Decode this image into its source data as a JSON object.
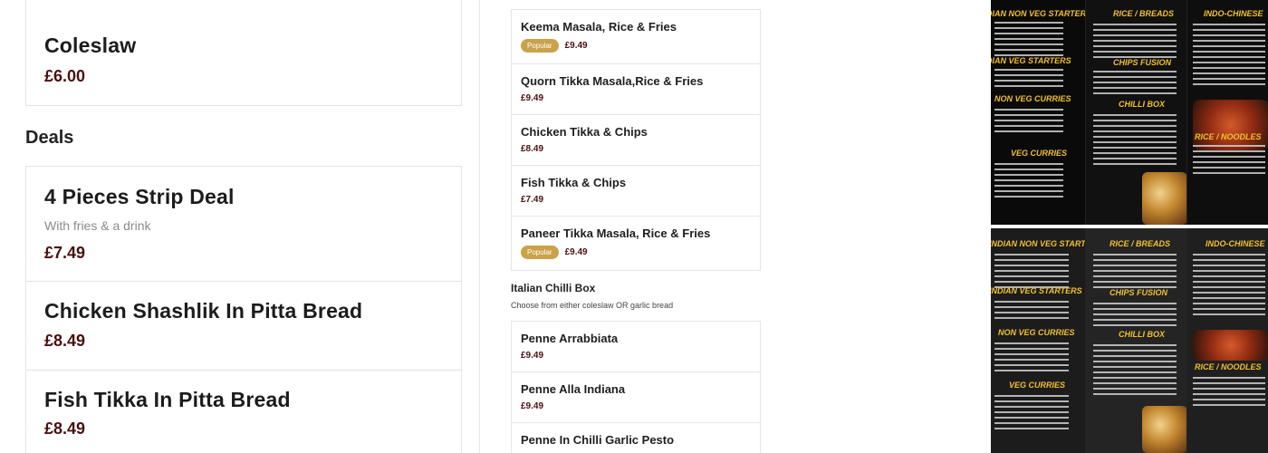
{
  "left": {
    "coleslaw": {
      "name": "Coleslaw",
      "price": "£6.00"
    },
    "deals_title": "Deals",
    "deals": [
      {
        "name": "4 Pieces Strip Deal",
        "desc": "With fries & a drink",
        "price": "£7.49"
      },
      {
        "name": "Chicken Shashlik In Pitta Bread",
        "price": "£8.49"
      },
      {
        "name": "Fish Tikka In Pitta Bread",
        "price": "£8.49"
      }
    ]
  },
  "middle": {
    "items": [
      {
        "name": "Keema Masala, Rice & Fries",
        "badge": "Popular",
        "price": "£9.49"
      },
      {
        "name": "Quorn Tikka Masala,Rice & Fries",
        "price": "£9.49"
      },
      {
        "name": "Chicken Tikka & Chips",
        "price": "£8.49"
      },
      {
        "name": "Fish Tikka & Chips",
        "price": "£7.49"
      },
      {
        "name": "Paneer Tikka Masala, Rice & Fries",
        "badge": "Popular",
        "price": "£9.49"
      }
    ],
    "category": {
      "title": "Italian Chilli Box",
      "subtitle": "Choose from either coleslaw OR garlic bread"
    },
    "category_items": [
      {
        "name": "Penne Arrabbiata",
        "price": "£9.49"
      },
      {
        "name": "Penne Alla Indiana",
        "price": "£9.49"
      },
      {
        "name": "Penne In Chilli Garlic Pesto"
      }
    ]
  },
  "menu_image": {
    "headings": [
      "INDIAN NON VEG STARTERS",
      "RICE / BREADS",
      "INDO-CHINESE",
      "INDIAN VEG STARTERS",
      "CHIPS FUSION",
      "NON VEG CURRIES",
      "CHILLI BOX",
      "RICE / NOODLES",
      "VEG CURRIES"
    ]
  },
  "colors": {
    "price": "#4a1010",
    "badge": "#c9a24a",
    "menu_heading": "#f2c12e"
  }
}
